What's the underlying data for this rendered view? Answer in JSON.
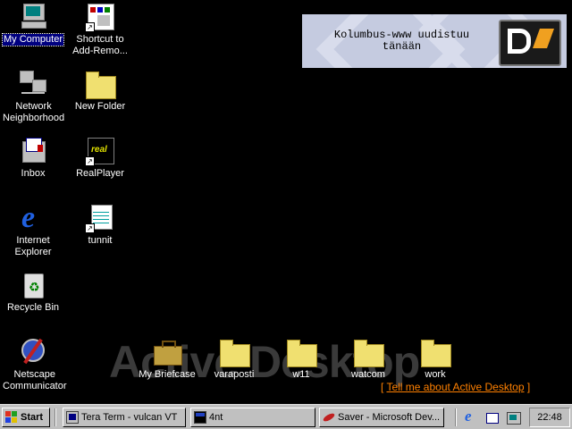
{
  "desktop": {
    "icons": [
      {
        "label": "My Computer",
        "icon": "my-computer-icon"
      },
      {
        "label": "Shortcut to Add-Remo...",
        "icon": "add-remove-programs-icon"
      },
      {
        "label": "Network Neighborhood",
        "icon": "network-neighborhood-icon"
      },
      {
        "label": "New Folder",
        "icon": "folder-icon"
      },
      {
        "label": "Inbox",
        "icon": "inbox-icon"
      },
      {
        "label": "RealPlayer",
        "icon": "realplayer-icon"
      },
      {
        "label": "Internet Explorer",
        "icon": "internet-explorer-icon"
      },
      {
        "label": "tunnit",
        "icon": "notepad-document-icon"
      },
      {
        "label": "Recycle Bin",
        "icon": "recycle-bin-icon"
      },
      {
        "label": "Netscape Communicator",
        "icon": "netscape-icon"
      },
      {
        "label": "My Briefcase",
        "icon": "briefcase-icon"
      },
      {
        "label": "varaposti",
        "icon": "folder-icon"
      },
      {
        "label": "w11",
        "icon": "folder-icon"
      },
      {
        "label": "watcom",
        "icon": "folder-icon"
      },
      {
        "label": "work",
        "icon": "folder-icon"
      }
    ],
    "watermark": "Active Desktop",
    "banner_text": "Kolumbus-www uudistuu tänään",
    "tell_me_prefix": "[ ",
    "tell_me_link": "Tell me about Active Desktop",
    "tell_me_suffix": " ]"
  },
  "taskbar": {
    "start_label": "Start",
    "tasks": [
      {
        "label": "Tera Term - vulcan VT",
        "icon": "tera-term-icon"
      },
      {
        "label": "4nt",
        "icon": "4nt-console-icon"
      },
      {
        "label": "Saver - Microsoft Dev...",
        "icon": "developer-studio-icon"
      }
    ],
    "quick_launch": [
      "internet-explorer-icon",
      "outlook-express-icon",
      "show-desktop-icon"
    ],
    "clock": "22:48"
  },
  "colors": {
    "desktop": "#000000",
    "taskbar": "#c0c0c0",
    "selection": "#000080",
    "link": "#ff8000",
    "folder": "#f0e070"
  }
}
